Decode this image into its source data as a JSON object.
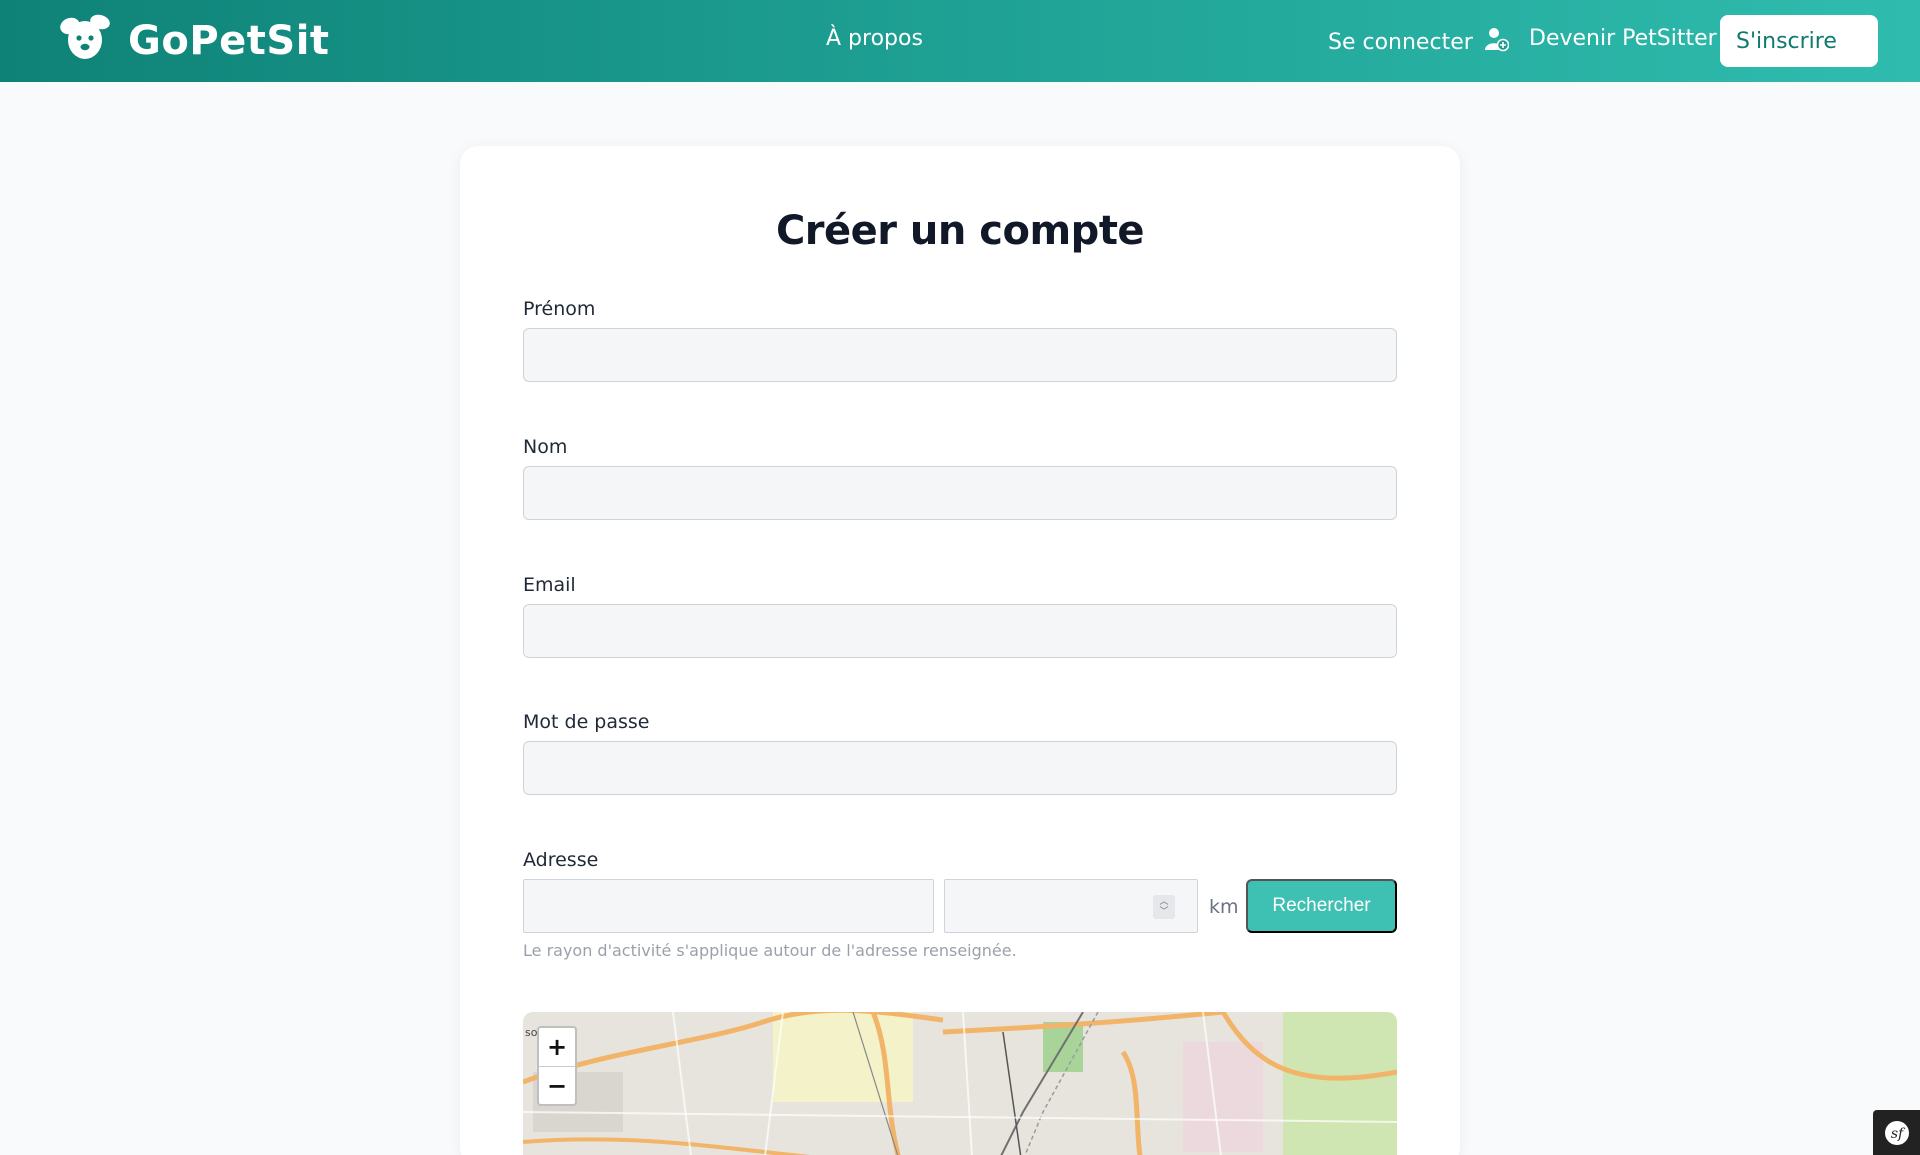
{
  "header": {
    "brand": "GoPetSit",
    "nav_about": "À propos",
    "nav_login": "Se connecter",
    "nav_petsitter": "Devenir PetSitter",
    "signup_button": "S'inscrire"
  },
  "form": {
    "title": "Créer un compte",
    "fields": [
      {
        "label": "Prénom",
        "value": ""
      },
      {
        "label": "Nom",
        "value": ""
      },
      {
        "label": "Email",
        "value": ""
      },
      {
        "label": "Mot de passe",
        "value": ""
      }
    ],
    "address": {
      "label": "Adresse",
      "value": "",
      "radius_value": "",
      "radius_unit": "km",
      "search_button": "Rechercher",
      "help": "Le rayon d'activité s'applique autour de l'adresse renseignée."
    }
  },
  "map": {
    "zoom_in": "+",
    "zoom_out": "−",
    "edge_text": "so"
  },
  "colors": {
    "header_start": "#0f8277",
    "header_end": "#2fbcae",
    "accent": "#3ec0b2",
    "signup_text": "#0f7a70"
  },
  "icons": {
    "logo": "dog-face-icon",
    "login": "user-add-icon",
    "debug": "symfony-icon"
  }
}
